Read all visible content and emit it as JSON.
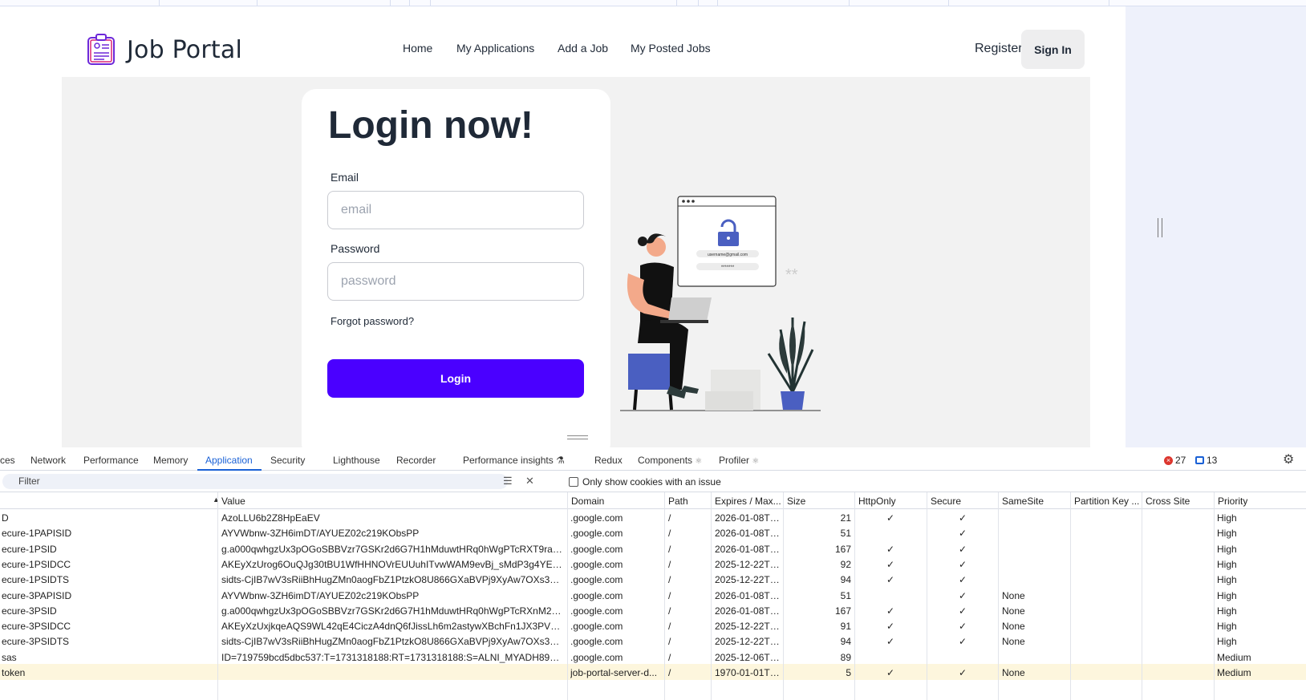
{
  "app": {
    "brand": "Job Portal",
    "nav": [
      "Home",
      "My Applications",
      "Add a Job",
      "My Posted Jobs"
    ],
    "register": "Register",
    "signin": "Sign In"
  },
  "login": {
    "title": "Login now!",
    "email_label": "Email",
    "email_placeholder": "email",
    "password_label": "Password",
    "password_placeholder": "password",
    "forgot": "Forgot password?",
    "button": "Login"
  },
  "illustration": {
    "email_text": "username@gmail.com",
    "password_text": "*******",
    "stars": "**"
  },
  "devtools": {
    "tabs": [
      "ces",
      "Network",
      "Performance",
      "Memory",
      "Application",
      "Security",
      "Lighthouse",
      "Recorder",
      "Performance insights",
      "Redux",
      "Components",
      "Profiler"
    ],
    "active_tab": "Application",
    "errors": "27",
    "messages": "13",
    "filter_placeholder": "Filter",
    "only_issue_label": "Only show cookies with an issue",
    "columns": [
      "",
      "Value",
      "Domain",
      "Path",
      "Expires / Max...",
      "Size",
      "HttpOnly",
      "Secure",
      "SameSite",
      "Partition Key ...",
      "Cross Site",
      "Priority"
    ],
    "rows": [
      {
        "name": "D",
        "value": "AzoLLU6b2Z8HpEaEV",
        "domain": ".google.com",
        "path": "/",
        "expires": "2026-01-08T1...",
        "size": "21",
        "httponly": "✓",
        "secure": "✓",
        "samesite": "",
        "priority": "High"
      },
      {
        "name": "ecure-1PAPISID",
        "value": "AYVWbnw-3ZH6imDT/AYUEZ02c219KObsPP",
        "domain": ".google.com",
        "path": "/",
        "expires": "2026-01-08T1...",
        "size": "51",
        "httponly": "",
        "secure": "✓",
        "samesite": "",
        "priority": "High"
      },
      {
        "name": "ecure-1PSID",
        "value": "g.a000qwhgzUx3pOGoSBBVzr7GSKr2d6G7H1hMduwtHRq0hWgPTcRXT9rac-hh5z...",
        "domain": ".google.com",
        "path": "/",
        "expires": "2026-01-08T1...",
        "size": "167",
        "httponly": "✓",
        "secure": "✓",
        "samesite": "",
        "priority": "High"
      },
      {
        "name": "ecure-1PSIDCC",
        "value": "AKEyXzUrog6OuQJg30tBU1WfHHNOVrEUUuhITvwWAM9evBj_sMdP3g4YEU3xld2...",
        "domain": ".google.com",
        "path": "/",
        "expires": "2025-12-22T0...",
        "size": "92",
        "httponly": "✓",
        "secure": "✓",
        "samesite": "",
        "priority": "High"
      },
      {
        "name": "ecure-1PSIDTS",
        "value": "sidts-CjIB7wV3sRiiBhHugZMn0aogFbZ1PtzkO8U866GXaBVPj9XyAw7OXs3TzP98Y_...",
        "domain": ".google.com",
        "path": "/",
        "expires": "2025-12-22T0...",
        "size": "94",
        "httponly": "✓",
        "secure": "✓",
        "samesite": "",
        "priority": "High"
      },
      {
        "name": "ecure-3PAPISID",
        "value": "AYVWbnw-3ZH6imDT/AYUEZ02c219KObsPP",
        "domain": ".google.com",
        "path": "/",
        "expires": "2026-01-08T1...",
        "size": "51",
        "httponly": "",
        "secure": "✓",
        "samesite": "None",
        "priority": "High"
      },
      {
        "name": "ecure-3PSID",
        "value": "g.a000qwhgzUx3pOGoSBBVzr7GSKr2d6G7H1hMduwtHRq0hWgPTcRXnM2Q1V28...",
        "domain": ".google.com",
        "path": "/",
        "expires": "2026-01-08T1...",
        "size": "167",
        "httponly": "✓",
        "secure": "✓",
        "samesite": "None",
        "priority": "High"
      },
      {
        "name": "ecure-3PSIDCC",
        "value": "AKEyXzUxjkqeAQS9WL42qE4CiczA4dnQ6fJissLh6m2astywXBchFn1JX3PVKR-SXgld...",
        "domain": ".google.com",
        "path": "/",
        "expires": "2025-12-22T0...",
        "size": "91",
        "httponly": "✓",
        "secure": "✓",
        "samesite": "None",
        "priority": "High"
      },
      {
        "name": "ecure-3PSIDTS",
        "value": "sidts-CjIB7wV3sRiiBhHugZMn0aogFbZ1PtzkO8U866GXaBVPj9XyAw7OXs3TzP98Y_...",
        "domain": ".google.com",
        "path": "/",
        "expires": "2025-12-22T0...",
        "size": "94",
        "httponly": "✓",
        "secure": "✓",
        "samesite": "None",
        "priority": "High"
      },
      {
        "name": "sas",
        "value": "ID=719759bcd5dbc537:T=1731318188:RT=1731318188:S=ALNI_MYADH89KbSdi...",
        "domain": ".google.com",
        "path": "/",
        "expires": "2025-12-06T0...",
        "size": "89",
        "httponly": "",
        "secure": "",
        "samesite": "",
        "priority": "Medium"
      },
      {
        "name": "token",
        "value": "",
        "domain": "job-portal-server-d...",
        "path": "/",
        "expires": "1970-01-01T0...",
        "size": "5",
        "httponly": "✓",
        "secure": "✓",
        "samesite": "None",
        "priority": "Medium"
      }
    ]
  },
  "colors": {
    "accent": "#4a00ff",
    "devtools_active": "#1a61d6",
    "hero_bg": "#f2f2f2",
    "illustration_blue": "#4a5fc1"
  }
}
